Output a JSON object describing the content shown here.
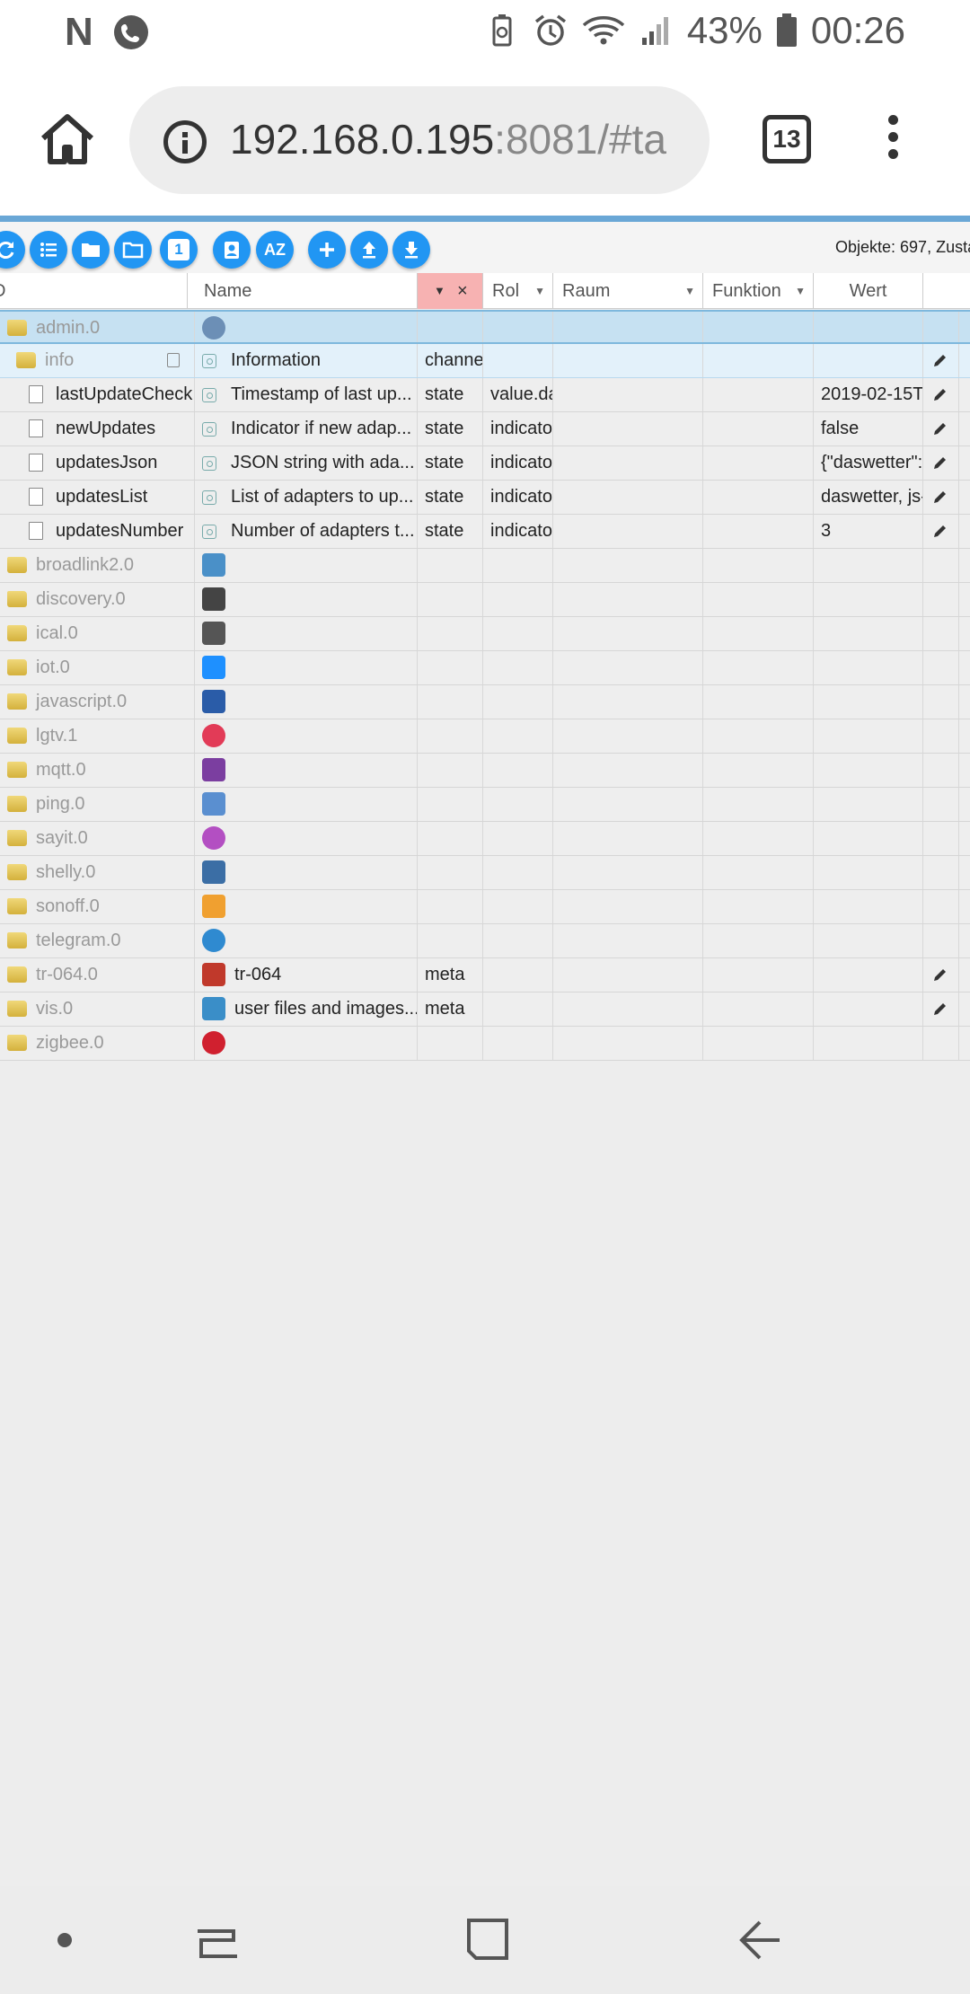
{
  "status_bar": {
    "left_glyph": "N",
    "battery_percent": "43%",
    "time": "00:26",
    "icons": [
      "n-icon",
      "phone-icon",
      "battery-saver-icon",
      "alarm-icon",
      "wifi-icon",
      "signal-icon",
      "battery-icon"
    ]
  },
  "browser": {
    "url_host": "192.168.0.195",
    "url_rest": ":8081/#ta",
    "tab_count": "13",
    "icons": [
      "home-icon",
      "info-icon",
      "tabs-icon",
      "overflow-menu-icon"
    ]
  },
  "toolbar": {
    "buttons": [
      "refresh",
      "list",
      "folder-closed",
      "folder-open",
      "one",
      "user-card",
      "sort-az",
      "add",
      "upload",
      "download"
    ],
    "one_label": "1",
    "az_label": "AZ",
    "objects_text": "Objekte: 697, Zusta"
  },
  "table": {
    "headers": {
      "id": "D",
      "name": "Name",
      "role": "Rol",
      "room": "Raum",
      "function": "Funktion",
      "value": "Wert"
    },
    "filter_clear": "×",
    "rows": [
      {
        "id": "admin.0",
        "name": "",
        "type": "",
        "role": "",
        "value": "",
        "kind": "adapter"
      },
      {
        "id": "info",
        "name": "Information",
        "type": "channe",
        "role": "",
        "value": "",
        "kind": "channel"
      },
      {
        "id": "lastUpdateCheck",
        "name": "Timestamp of last up...",
        "type": "state",
        "role": "value.da",
        "value": "2019-02-15T",
        "kind": "state"
      },
      {
        "id": "newUpdates",
        "name": "Indicator if new adap...",
        "type": "state",
        "role": "indicato",
        "value": "false",
        "kind": "state"
      },
      {
        "id": "updatesJson",
        "name": "JSON string with ada...",
        "type": "state",
        "role": "indicato",
        "value": "{\"daswetter\":",
        "kind": "state"
      },
      {
        "id": "updatesList",
        "name": "List of adapters to up...",
        "type": "state",
        "role": "indicato",
        "value": "daswetter, js-",
        "kind": "state"
      },
      {
        "id": "updatesNumber",
        "name": "Number of adapters t...",
        "type": "state",
        "role": "indicato",
        "value": "3",
        "kind": "state"
      },
      {
        "id": "broadlink2.0",
        "name": "",
        "type": "",
        "role": "",
        "value": "",
        "kind": "adapter"
      },
      {
        "id": "discovery.0",
        "name": "",
        "type": "",
        "role": "",
        "value": "",
        "kind": "adapter"
      },
      {
        "id": "ical.0",
        "name": "",
        "type": "",
        "role": "",
        "value": "",
        "kind": "adapter"
      },
      {
        "id": "iot.0",
        "name": "",
        "type": "",
        "role": "",
        "value": "",
        "kind": "adapter"
      },
      {
        "id": "javascript.0",
        "name": "",
        "type": "",
        "role": "",
        "value": "",
        "kind": "adapter"
      },
      {
        "id": "lgtv.1",
        "name": "",
        "type": "",
        "role": "",
        "value": "",
        "kind": "adapter"
      },
      {
        "id": "mqtt.0",
        "name": "",
        "type": "",
        "role": "",
        "value": "",
        "kind": "adapter"
      },
      {
        "id": "ping.0",
        "name": "",
        "type": "",
        "role": "",
        "value": "",
        "kind": "adapter"
      },
      {
        "id": "sayit.0",
        "name": "",
        "type": "",
        "role": "",
        "value": "",
        "kind": "adapter"
      },
      {
        "id": "shelly.0",
        "name": "",
        "type": "",
        "role": "",
        "value": "",
        "kind": "adapter"
      },
      {
        "id": "sonoff.0",
        "name": "",
        "type": "",
        "role": "",
        "value": "",
        "kind": "adapter"
      },
      {
        "id": "telegram.0",
        "name": "",
        "type": "",
        "role": "",
        "value": "",
        "kind": "adapter"
      },
      {
        "id": "tr-064.0",
        "name": "tr-064",
        "type": "meta",
        "role": "",
        "value": "",
        "kind": "meta"
      },
      {
        "id": "vis.0",
        "name": "user files and images...",
        "type": "meta",
        "role": "",
        "value": "",
        "kind": "meta"
      },
      {
        "id": "zigbee.0",
        "name": "",
        "type": "",
        "role": "",
        "value": "",
        "kind": "adapter"
      }
    ]
  },
  "colors": {
    "accent_blue": "#2196f3",
    "selected_row": "#c6e1f2",
    "filter_red": "#f7b2b2"
  },
  "nav_bar": {
    "icons": [
      "nav-dot-icon",
      "recents-icon",
      "home-square-icon",
      "back-icon"
    ]
  }
}
